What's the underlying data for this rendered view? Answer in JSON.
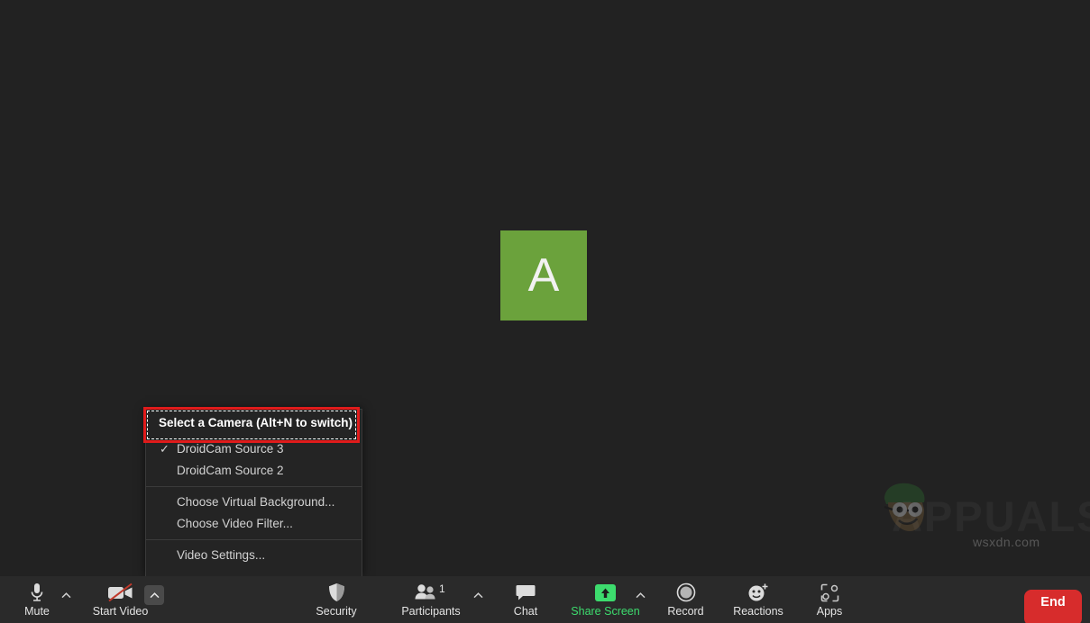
{
  "meeting": {
    "avatar_letter": "A",
    "avatar_color": "#6ba23c",
    "background_color": "#222222"
  },
  "watermark": {
    "text": "APPUALS",
    "url": "wsxdn.com"
  },
  "camera_menu": {
    "header": "Select a Camera (Alt+N to switch)",
    "annotation_color": "#e01b1b",
    "groups": [
      {
        "items": [
          {
            "label": "DroidCam Source 3",
            "checked": true
          },
          {
            "label": "DroidCam Source 2",
            "checked": false
          }
        ]
      },
      {
        "items": [
          {
            "label": "Choose Virtual Background...",
            "checked": false
          },
          {
            "label": "Choose Video Filter...",
            "checked": false
          }
        ]
      },
      {
        "items": [
          {
            "label": "Video Settings...",
            "checked": false
          }
        ]
      }
    ]
  },
  "toolbar": {
    "mute_label": "Mute",
    "video_label": "Start Video",
    "security_label": "Security",
    "participants_label": "Participants",
    "participants_count": "1",
    "chat_label": "Chat",
    "share_label": "Share Screen",
    "share_color": "#3ddc6e",
    "record_label": "Record",
    "reactions_label": "Reactions",
    "apps_label": "Apps",
    "end_label": "End",
    "end_color": "#d72c2c"
  }
}
